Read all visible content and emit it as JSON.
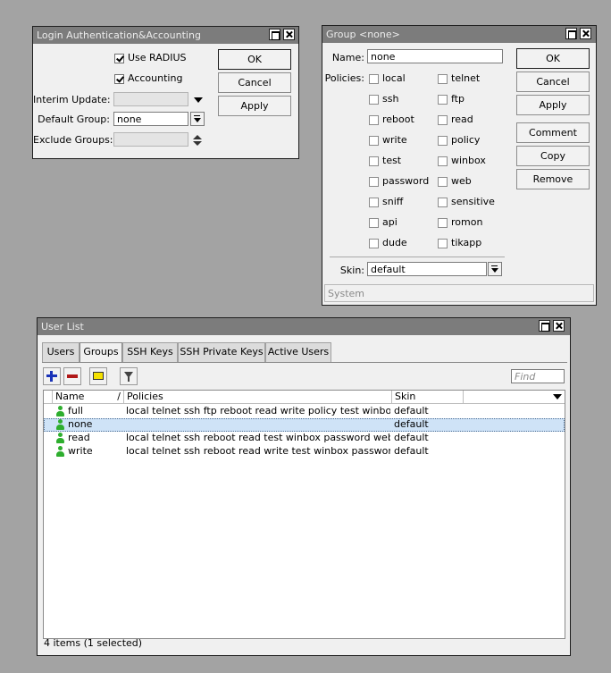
{
  "login_window": {
    "title": "Login Authentication&Accounting",
    "use_radius_label": "Use RADIUS",
    "use_radius_checked": true,
    "accounting_label": "Accounting",
    "accounting_checked": true,
    "interim_update_label": "Interim Update:",
    "interim_update_value": "",
    "default_group_label": "Default Group:",
    "default_group_value": "none",
    "exclude_groups_label": "Exclude Groups:",
    "exclude_groups_value": "",
    "ok_label": "OK",
    "cancel_label": "Cancel",
    "apply_label": "Apply"
  },
  "group_window": {
    "title": "Group <none>",
    "name_label": "Name:",
    "name_value": "none",
    "policies_label": "Policies:",
    "policies_left": [
      {
        "label": "local",
        "checked": false
      },
      {
        "label": "ssh",
        "checked": false
      },
      {
        "label": "reboot",
        "checked": false
      },
      {
        "label": "write",
        "checked": false
      },
      {
        "label": "test",
        "checked": false
      },
      {
        "label": "password",
        "checked": false
      },
      {
        "label": "sniff",
        "checked": false
      },
      {
        "label": "api",
        "checked": false
      },
      {
        "label": "dude",
        "checked": false
      }
    ],
    "policies_right": [
      {
        "label": "telnet",
        "checked": false
      },
      {
        "label": "ftp",
        "checked": false
      },
      {
        "label": "read",
        "checked": false
      },
      {
        "label": "policy",
        "checked": false
      },
      {
        "label": "winbox",
        "checked": false
      },
      {
        "label": "web",
        "checked": false
      },
      {
        "label": "sensitive",
        "checked": false
      },
      {
        "label": "romon",
        "checked": false
      },
      {
        "label": "tikapp",
        "checked": false
      }
    ],
    "skin_label": "Skin:",
    "skin_value": "default",
    "status": "System",
    "ok_label": "OK",
    "cancel_label": "Cancel",
    "apply_label": "Apply",
    "comment_label": "Comment",
    "copy_label": "Copy",
    "remove_label": "Remove"
  },
  "user_list_window": {
    "title": "User List",
    "tabs": [
      {
        "label": "Users",
        "active": false
      },
      {
        "label": "Groups",
        "active": true
      },
      {
        "label": "SSH Keys",
        "active": false
      },
      {
        "label": "SSH Private Keys",
        "active": false
      },
      {
        "label": "Active Users",
        "active": false
      }
    ],
    "toolbar_icons": [
      "add-icon",
      "remove-icon",
      "comment-icon",
      "filter-icon"
    ],
    "find_placeholder": "Find",
    "columns": [
      "Name",
      "Policies",
      "Skin"
    ],
    "rows": [
      {
        "name": "full",
        "policies": "local telnet ssh ftp reboot read write policy test winbox passw...",
        "skin": "default",
        "selected": false
      },
      {
        "name": "none",
        "policies": "",
        "skin": "default",
        "selected": true
      },
      {
        "name": "read",
        "policies": "local telnet ssh reboot read test winbox password web sniff s...",
        "skin": "default",
        "selected": false
      },
      {
        "name": "write",
        "policies": "local telnet ssh reboot read write test winbox password web ...",
        "skin": "default",
        "selected": false
      }
    ],
    "status": "4 items (1 selected)"
  }
}
